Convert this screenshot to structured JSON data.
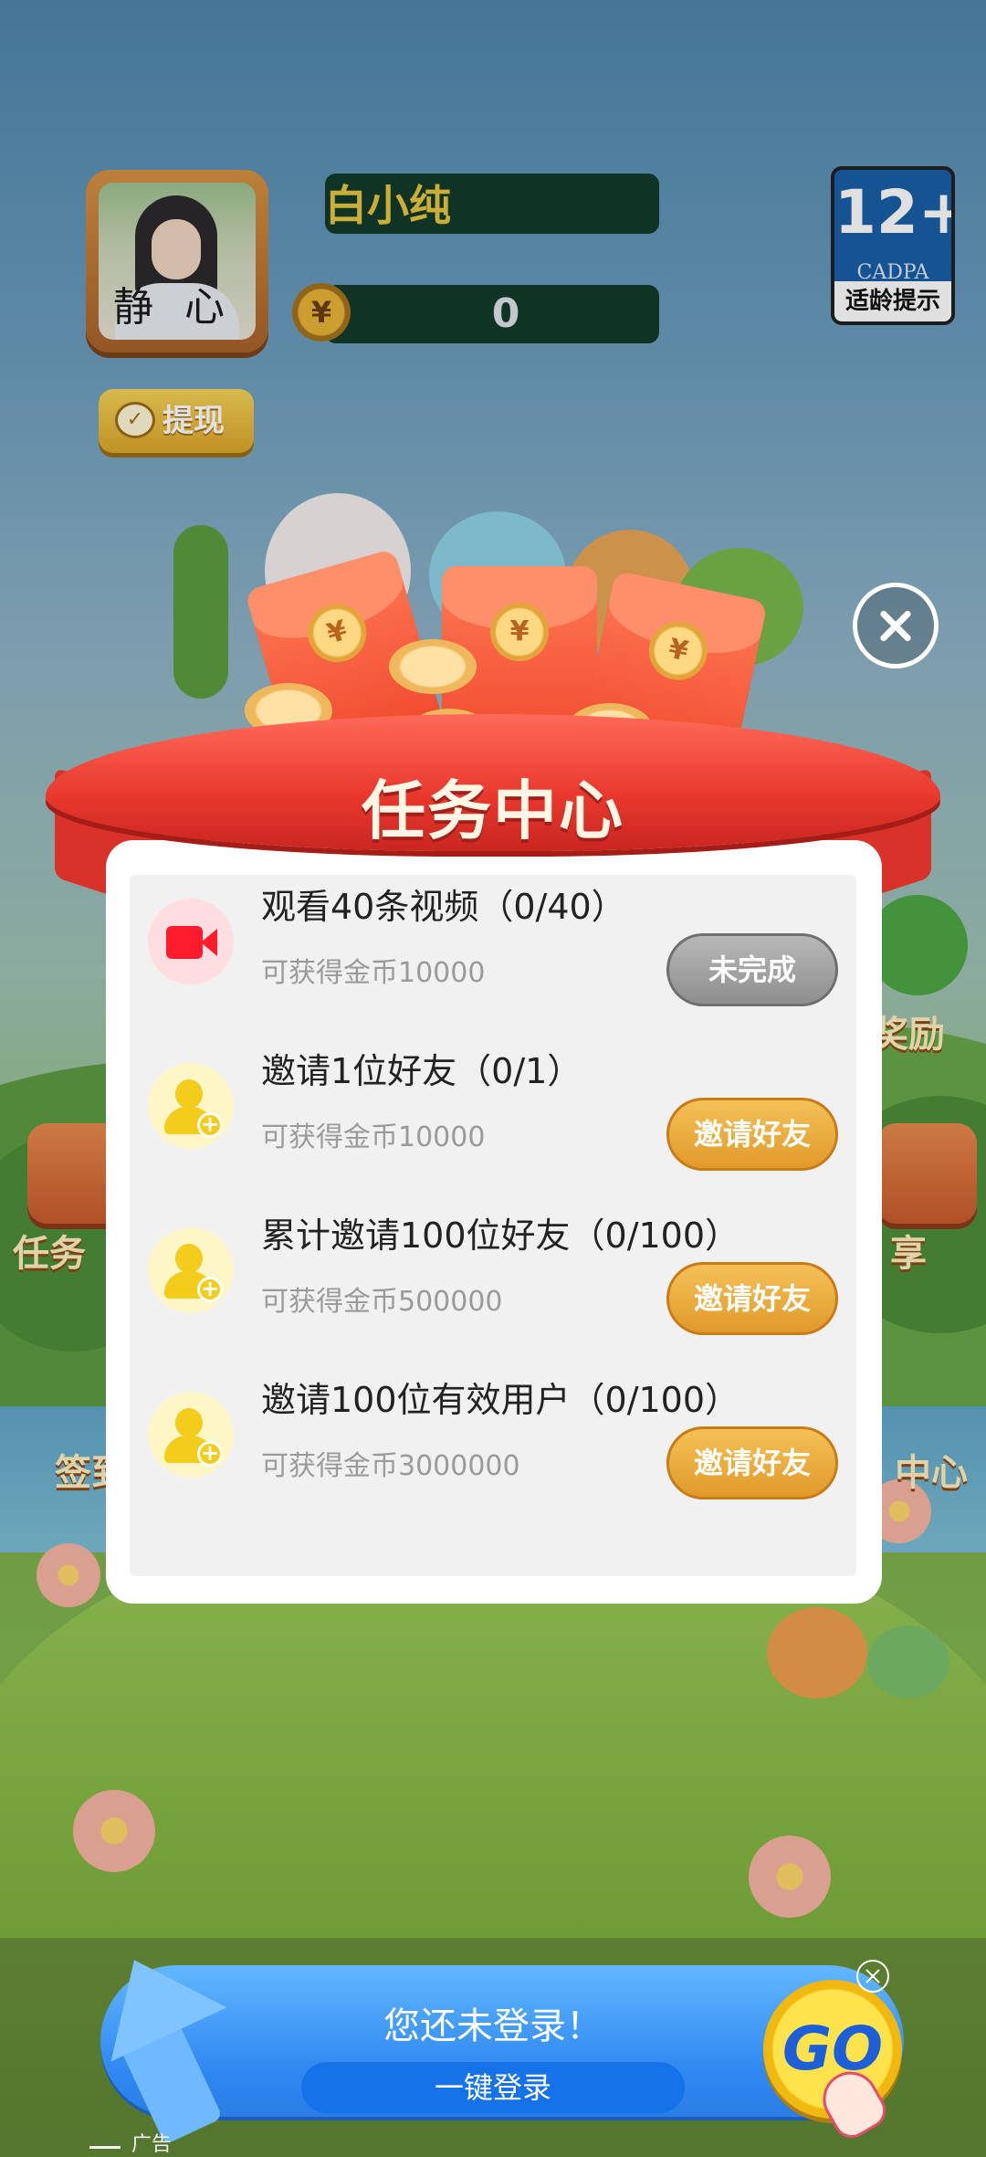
{
  "header": {
    "player_name": "白小纯",
    "coin_symbol": "¥",
    "coin_balance": "0",
    "withdraw_label": "提现",
    "avatar_calligraphy": "静 心"
  },
  "age_badge": {
    "rating": "12+",
    "org": "CADPA",
    "tip": "适龄提示"
  },
  "background": {
    "left_side_label": "任务",
    "right_side_label": "奖励",
    "right_side_label2": "享",
    "left_bottom_label": "签到",
    "right_bottom_label": "中心"
  },
  "dialog": {
    "title": "任务中心",
    "packet_symbol": "¥",
    "tasks": [
      {
        "title": "观看40条视频（0/40）",
        "reward": "可获得金币10000",
        "button": "未完成",
        "icon": "video-camera-icon"
      },
      {
        "title": "邀请1位好友（0/1）",
        "reward": "可获得金币10000",
        "button": "邀请好友",
        "icon": "add-user-icon"
      },
      {
        "title": "累计邀请100位好友（0/100）",
        "reward": "可获得金币500000",
        "button": "邀请好友",
        "icon": "add-user-icon"
      },
      {
        "title": "邀请100位有效用户（0/100）",
        "reward": "可获得金币3000000",
        "button": "邀请好友",
        "icon": "add-user-icon"
      }
    ]
  },
  "login_banner": {
    "title": "您还未登录！",
    "button": "一键登录",
    "go": "GO",
    "ad_label": "广告"
  },
  "colors": {
    "ribbon_red": "#e8382e",
    "invite_orange": "#e19a2a",
    "done_gray": "#8e8e8e",
    "banner_blue": "#2f88f0"
  }
}
